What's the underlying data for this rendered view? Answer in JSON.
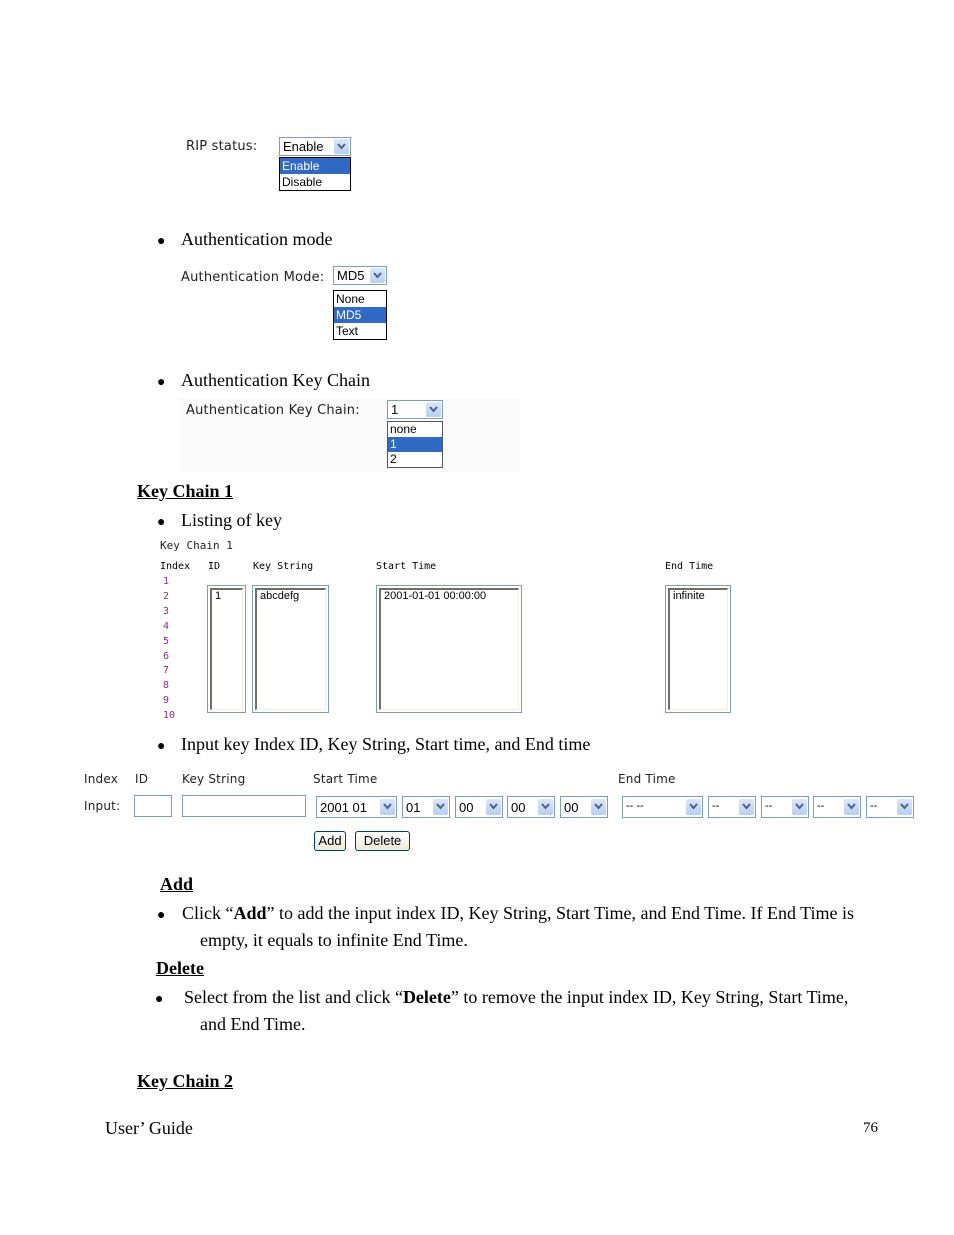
{
  "rip_status": {
    "label": "RIP status:",
    "selected": "Enable",
    "options": [
      "Enable",
      "Disable"
    ],
    "highlighted": "Enable"
  },
  "auth_mode_bullet": "Authentication mode",
  "auth_mode": {
    "label": "Authentication Mode:",
    "selected": "MD5",
    "options": [
      "None",
      "MD5",
      "Text"
    ],
    "highlighted": "MD5"
  },
  "auth_keychain_bullet": "Authentication Key Chain",
  "auth_keychain": {
    "label": "Authentication Key Chain:",
    "selected": "1",
    "options": [
      "none",
      "1",
      "2"
    ],
    "highlighted": "1"
  },
  "keychain1_heading": "Key Chain 1",
  "listing_bullet": "Listing of key",
  "listing": {
    "title": "Key Chain 1",
    "headers": {
      "index": "Index",
      "id": "ID",
      "key_string": "Key String",
      "start_time": "Start Time",
      "end_time": "End Time"
    },
    "indexes": [
      "1",
      "2",
      "3",
      "4",
      "5",
      "6",
      "7",
      "8",
      "9",
      "10"
    ],
    "rows": [
      {
        "id": "1",
        "key_string": "abcdefg",
        "start_time": "2001-01-01 00:00:00",
        "end_time": "infinite"
      }
    ]
  },
  "input_bullet": "Input key Index ID, Key String, Start time, and End time",
  "input_form": {
    "headers": {
      "index": "Index",
      "id": "ID",
      "key_string": "Key String",
      "start_time": "Start Time",
      "end_time": "End Time"
    },
    "row_label": "Input:",
    "id_value": "",
    "key_string_value": "",
    "start_time": [
      "2001 01",
      "01",
      "00",
      "00",
      "00"
    ],
    "end_time": [
      "-- --",
      "--",
      "--",
      "--",
      "--"
    ],
    "add_label": "Add",
    "delete_label": "Delete"
  },
  "add_section": {
    "heading": "Add",
    "text_pre": "Click “",
    "text_bold": "Add",
    "text_post": "” to add the input index ID, Key String, Start Time, and End Time. If End Time is",
    "text_cont": "empty, it equals to infinite End Time."
  },
  "delete_section": {
    "heading": "Delete",
    "text_pre": "Select from the list and click “",
    "text_bold": "Delete",
    "text_post": "” to remove the input index ID, Key String, Start Time,",
    "text_cont": "and End Time."
  },
  "keychain2_heading": "Key Chain 2",
  "footer": {
    "left": "User’ Guide",
    "page_number": "76"
  }
}
